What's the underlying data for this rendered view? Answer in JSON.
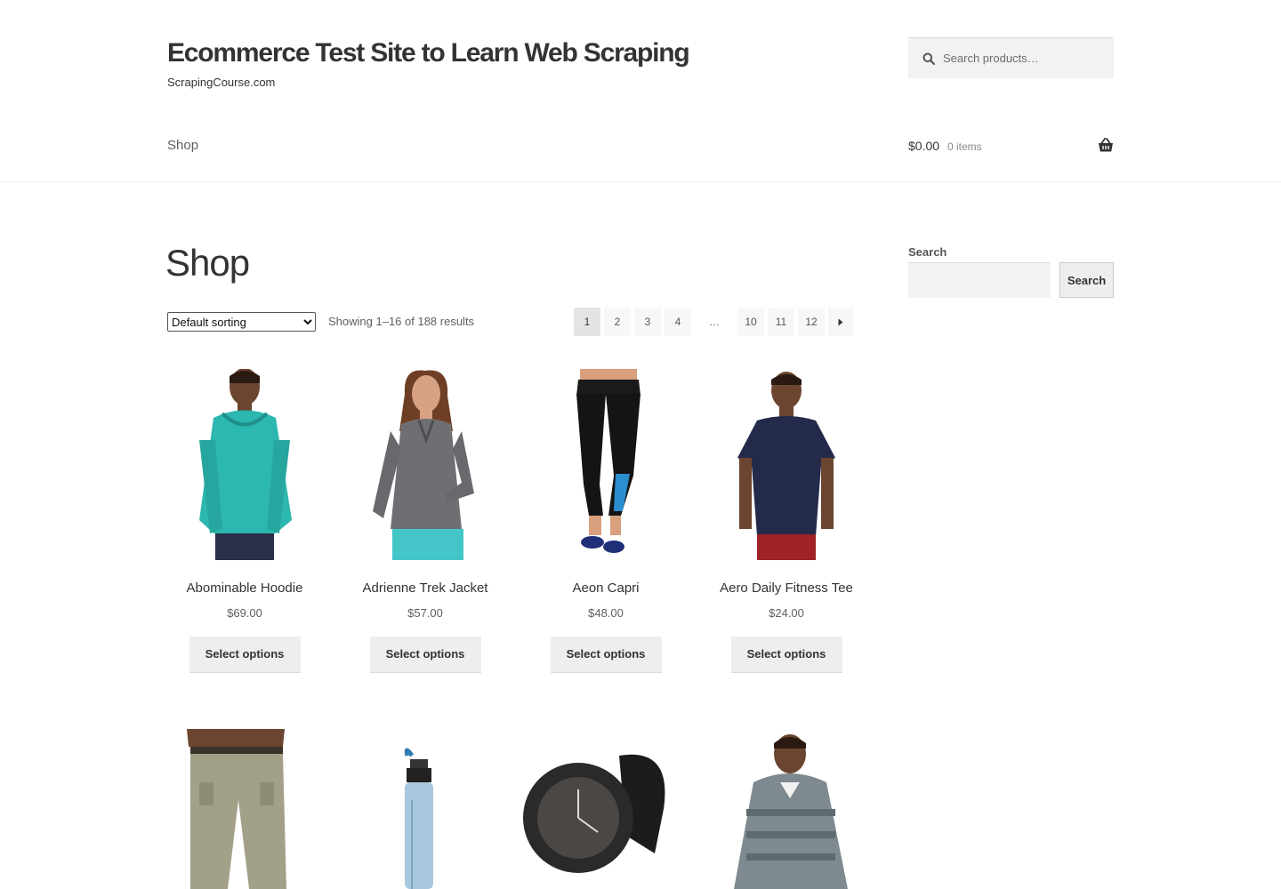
{
  "header": {
    "site_title": "Ecommerce Test Site to Learn Web Scraping",
    "tagline": "ScrapingCourse.com",
    "search_placeholder": "Search products…",
    "nav": {
      "shop": "Shop"
    },
    "cart": {
      "total": "$0.00",
      "count": "0 items"
    }
  },
  "main": {
    "title": "Shop",
    "sorting": {
      "selected": "Default sorting"
    },
    "result_count": "Showing 1–16 of 188 results",
    "pagination": {
      "pages": [
        "1",
        "2",
        "3",
        "4"
      ],
      "dots": "…",
      "last_pages": [
        "10",
        "11",
        "12"
      ],
      "current": "1"
    },
    "products": [
      {
        "name": "Abominable Hoodie",
        "price": "$69.00",
        "button": "Select options"
      },
      {
        "name": "Adrienne Trek Jacket",
        "price": "$57.00",
        "button": "Select options"
      },
      {
        "name": "Aeon Capri",
        "price": "$48.00",
        "button": "Select options"
      },
      {
        "name": "Aero Daily Fitness Tee",
        "price": "$24.00",
        "button": "Select options"
      }
    ]
  },
  "sidebar": {
    "search_label": "Search",
    "search_button": "Search"
  },
  "colors": {
    "background": "#ffffff",
    "text": "#333333",
    "button_bg": "#eeeeee",
    "input_bg": "#f2f2f2"
  }
}
